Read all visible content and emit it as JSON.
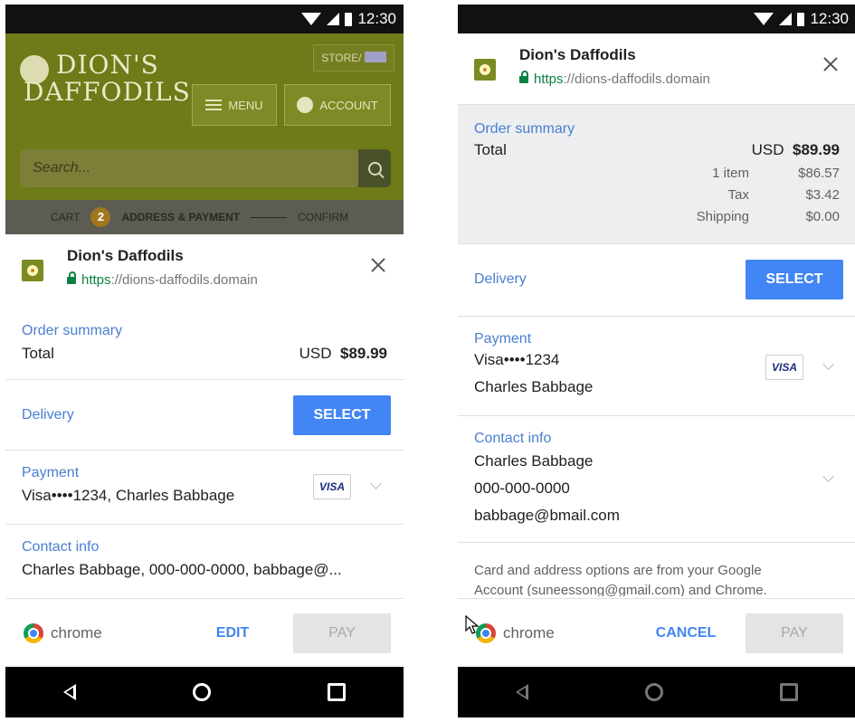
{
  "status": {
    "time": "12:30"
  },
  "site": {
    "logo_line1": "DION'S",
    "logo_line2": "DAFFODILS.",
    "store_label": "STORE/",
    "menu_label": "MENU",
    "account_label": "ACCOUNT",
    "search_placeholder": "Search...",
    "steps": {
      "cart": "CART",
      "number": "2",
      "address_payment": "ADDRESS & PAYMENT",
      "confirm": "CONFIRM"
    }
  },
  "left": {
    "merchant_name": "Dion's Daffodils",
    "url_scheme": "https",
    "url_rest": "://dions-daffodils.domain",
    "order_summary_label": "Order summary",
    "total_label": "Total",
    "total_currency": "USD",
    "total_amount": "$89.99",
    "delivery_label": "Delivery",
    "select_label": "SELECT",
    "payment_label": "Payment",
    "payment_value": "Visa••••1234, Charles Babbage",
    "visa_label": "VISA",
    "contact_label": "Contact info",
    "contact_value": "Charles Babbage, 000-000-0000, babbage@...",
    "chrome_label": "chrome",
    "edit_label": "EDIT",
    "pay_label": "PAY"
  },
  "right": {
    "merchant_name": "Dion's Daffodils",
    "url_scheme": "https",
    "url_rest": "://dions-daffodils.domain",
    "order_summary_label": "Order summary",
    "total_label": "Total",
    "total_currency": "USD",
    "total_amount": "$89.99",
    "breakdown": [
      {
        "label": "1 item",
        "value": "$86.57"
      },
      {
        "label": "Tax",
        "value": "$3.42"
      },
      {
        "label": "Shipping",
        "value": "$0.00"
      }
    ],
    "delivery_label": "Delivery",
    "select_label": "SELECT",
    "payment_label": "Payment",
    "payment_card": "Visa••••1234",
    "payment_name": "Charles Babbage",
    "visa_label": "VISA",
    "contact_label": "Contact info",
    "contact_name": "Charles Babbage",
    "contact_phone": "000-000-0000",
    "contact_email": "babbage@bmail.com",
    "disclaimer_line1": "Card and address options are from your Google",
    "disclaimer_line2": "Account (suneessong@gmail.com) and Chrome.",
    "chrome_label": "chrome",
    "cancel_label": "CANCEL",
    "pay_label": "PAY"
  },
  "colors": {
    "accent": "#4285f4",
    "link": "#4a7fcf",
    "secure": "#0b8043",
    "site_bg": "#6f7a18"
  }
}
